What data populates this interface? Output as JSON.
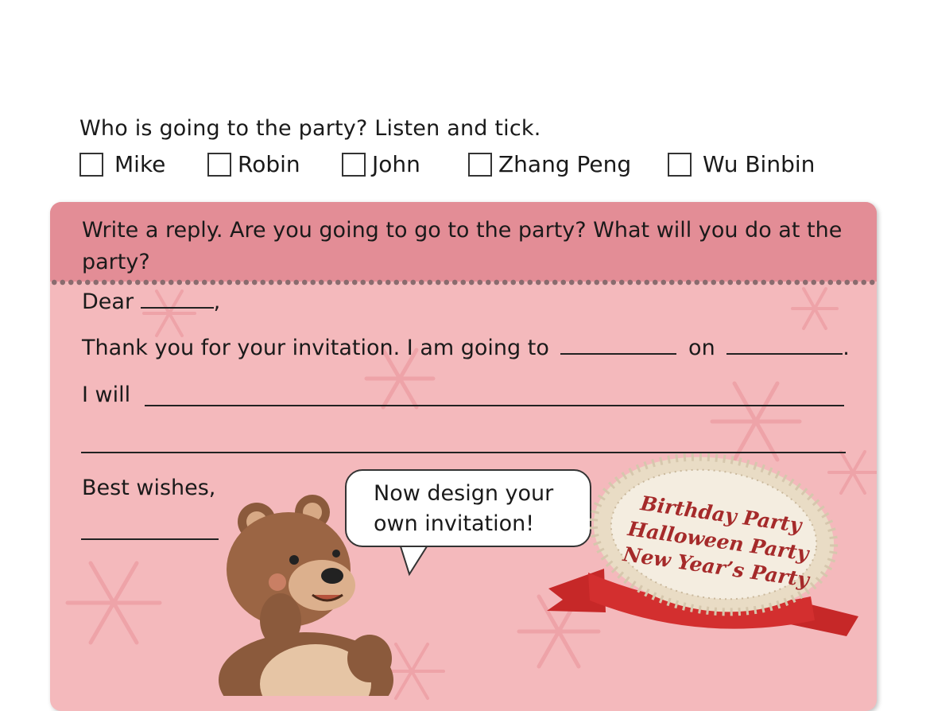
{
  "listening": {
    "question": "Who is going to the party? Listen and tick.",
    "options": [
      "Mike",
      "Robin",
      "John",
      "Zhang Peng",
      "Wu Binbin"
    ]
  },
  "writing": {
    "instruction": "Write a reply. Are you going to go to the party? What will you do at the party?",
    "letter": {
      "greeting": "Dear",
      "greeting_punct": ",",
      "line1_start": "Thank you for your invitation. I am going to",
      "line1_mid": "on",
      "line1_end": ".",
      "line2_start": "I will",
      "closing": "Best wishes,"
    },
    "speech_bubble": [
      "Now design your",
      "own invitation!"
    ],
    "badge_items": [
      "Birthday Party",
      "Halloween Party",
      "New Year’s Party"
    ]
  },
  "colors": {
    "card_background": "#f4b9bc",
    "header_band": "#e38d96",
    "badge_text": "#a52a2a",
    "ribbon": "#c62828"
  }
}
